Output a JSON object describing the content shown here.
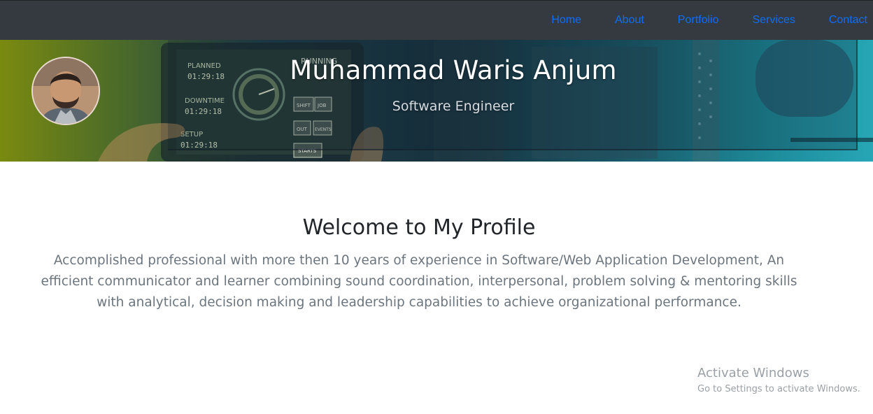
{
  "navbar": {
    "items": [
      {
        "label": "Home"
      },
      {
        "label": "About"
      },
      {
        "label": "Portfolio"
      },
      {
        "label": "Services"
      },
      {
        "label": "Contact"
      }
    ]
  },
  "hero": {
    "name": "Muhammad Waris Anjum",
    "role": "Software Engineer",
    "avatar_icon": "profile-photo",
    "background_screen_text": [
      "PLANNED",
      "01:29:18",
      "DOWNTIME",
      "01:29:18",
      "SETUP",
      "01:29:18",
      "RUNNING",
      "SHIFT",
      "JOB",
      "OUT",
      "EVENTS",
      "STARTS"
    ]
  },
  "main": {
    "welcome_title": "Welcome to My Profile",
    "intro": "Accomplished professional with more then 10 years of experience in Software/Web Application Development, An efficient communicator and learner combining sound coordination, interpersonal, problem solving & mentoring skills with analytical, decision making and leadership capabilities to achieve organizational performance."
  },
  "watermark": {
    "title": "Activate Windows",
    "subtitle": "Go to Settings to activate Windows."
  },
  "colors": {
    "navbar_bg": "#343a40",
    "nav_link": "#0d6efd",
    "heading": "#212529",
    "body_text": "#6c757d"
  }
}
